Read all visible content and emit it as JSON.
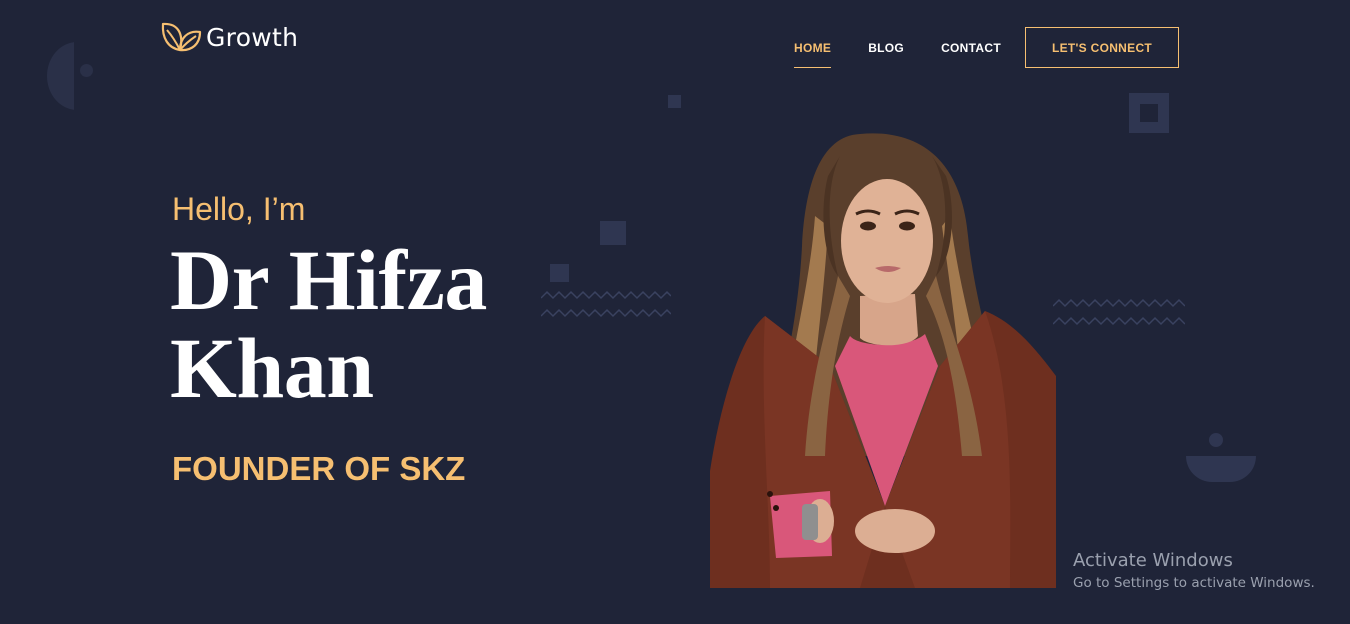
{
  "brand": {
    "name": "Growth",
    "icon": "leaf-icon"
  },
  "nav": {
    "items": [
      {
        "label": "HOME",
        "active": true
      },
      {
        "label": "BLOG",
        "active": false
      },
      {
        "label": "CONTACT",
        "active": false
      }
    ],
    "cta_label": "LET'S CONNECT"
  },
  "hero": {
    "greeting": "Hello, I’m",
    "name_line1": "Dr Hifza",
    "name_line2": "Khan",
    "role": "FOUNDER OF SKZ",
    "portrait_alt": "portrait"
  },
  "watermark": {
    "title": "Activate Windows",
    "subtitle": "Go to Settings to activate Windows."
  },
  "colors": {
    "background": "#1f2438",
    "accent": "#f6bf71",
    "text": "#ffffff",
    "shape": "#2f3651"
  }
}
